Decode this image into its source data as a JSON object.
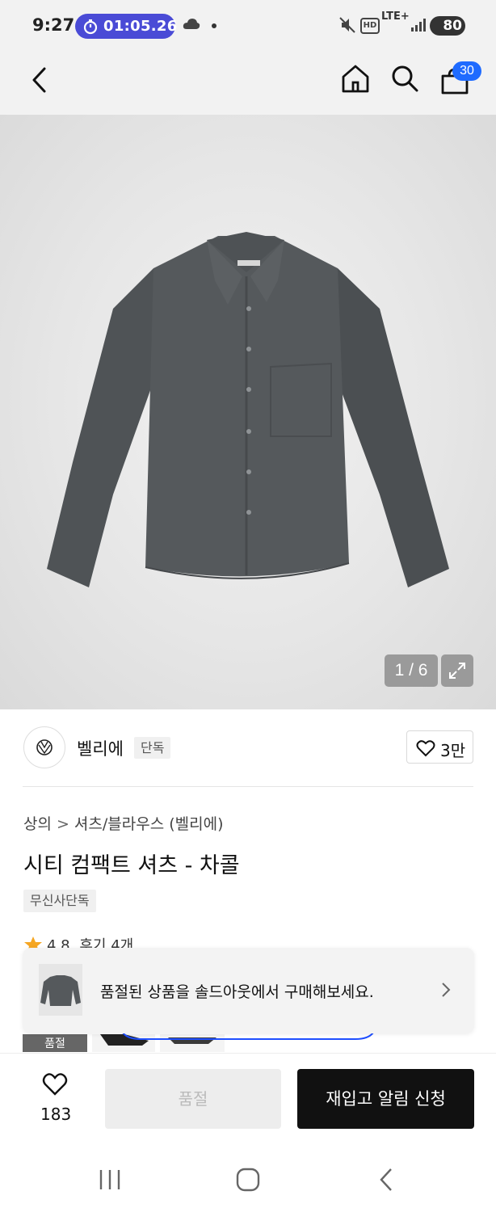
{
  "status_bar": {
    "time": "9:27",
    "timer": "01:05.26",
    "network": "LTE+",
    "hd_label": "HD",
    "battery": "80"
  },
  "header": {
    "cart_count": "30"
  },
  "gallery": {
    "counter": "1 / 6"
  },
  "brand": {
    "name": "벨리에",
    "tag": "단독",
    "likes": "3만"
  },
  "product": {
    "breadcrumb": [
      "상의",
      "셔츠/블라우스 (벨리에)"
    ],
    "title": "시티 컴팩트 셔츠 - 차콜",
    "tag": "무신사단독",
    "rating": "4.8",
    "review_label": "후기 4개"
  },
  "toast": {
    "message": "품절된 상품을 솔드아웃에서 구매해보세요."
  },
  "thumbs": {
    "soldout_label": "품절"
  },
  "bottom_bar": {
    "wish_count": "183",
    "soldout_label": "품절",
    "restock_label": "재입고 알림 신청"
  },
  "colors": {
    "accent_blue": "#1f6bff",
    "timer_purple": "#4a4bd6",
    "shirt": "#53575a",
    "star": "#f5a623"
  }
}
